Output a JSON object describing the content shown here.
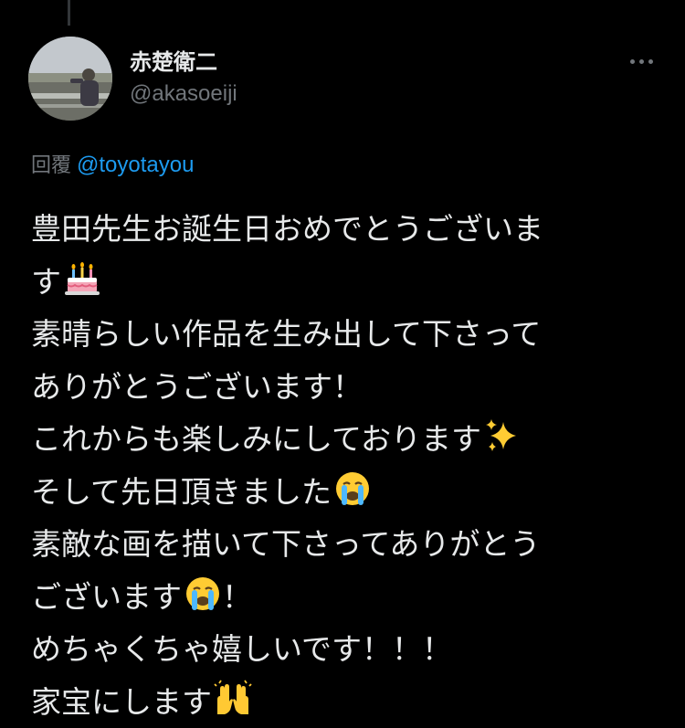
{
  "tweet": {
    "author": {
      "display_name": "赤楚衛二",
      "handle": "@akasoeiji"
    },
    "reply": {
      "label": "回覆",
      "mention": "@toyotayou"
    },
    "lines": [
      {
        "text": "豊田先生お誕生日おめでとうございま"
      },
      {
        "text": "す",
        "emoji": "birthday-cake",
        "after": ""
      },
      {
        "text": "素晴らしい作品を生み出して下さって"
      },
      {
        "text": "ありがとうございます！"
      },
      {
        "text": "これからも楽しみにしております",
        "emoji": "sparkles",
        "after": ""
      },
      {
        "text": "そして先日頂きました",
        "emoji": "loudly-crying-face",
        "after": ""
      },
      {
        "text": "素敵な画を描いて下さってありがとう"
      },
      {
        "text": "ございます",
        "emoji": "loudly-crying-face",
        "after": "！"
      },
      {
        "text": "めちゃくちゃ嬉しいです！！！"
      },
      {
        "text": "家宝にします",
        "emoji": "raising-hands",
        "after": ""
      }
    ]
  },
  "colors": {
    "background": "#000000",
    "primary_text": "#e7e9ea",
    "secondary_text": "#71767b",
    "link": "#1d9bf0"
  }
}
